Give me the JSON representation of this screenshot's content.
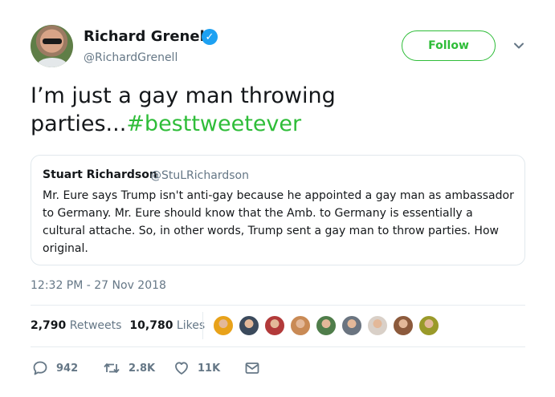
{
  "author": {
    "display_name": "Richard Grenell",
    "verified_mark": "✓",
    "handle": "@RichardGrenell"
  },
  "follow_label": "Follow",
  "tweet": {
    "text": "I’m just a gay man throwing parties...",
    "hashtag": "#besttweetever"
  },
  "quoted_tweet": {
    "display_name": "Stuart Richardson",
    "handle": "@StuLRichardson",
    "text": "Mr. Eure says Trump isn't anti-gay because he appointed a gay man as ambassador to Germany. Mr. Eure should know that the Amb. to Germany is essentially a cultural attache. So, in other words, Trump sent a gay man to throw parties. How original."
  },
  "timestamp": "12:32 PM - 27 Nov 2018",
  "stats": {
    "retweets_count": "2,790",
    "retweets_label": "Retweets",
    "likes_count": "10,780",
    "likes_label": "Likes"
  },
  "liker_avatar_colors": [
    "#e8a21a",
    "#3b4a5c",
    "#b23a3a",
    "#c98a55",
    "#4f7d4a",
    "#6a7480",
    "#d9d0c8",
    "#8c5a3c",
    "#9a9a2a"
  ],
  "actions": {
    "replies": "942",
    "retweets": "2.8K",
    "likes": "11K"
  },
  "colors": {
    "accent_green": "#2fbd39",
    "verified_blue": "#1da1f2",
    "secondary_text": "#657786"
  }
}
